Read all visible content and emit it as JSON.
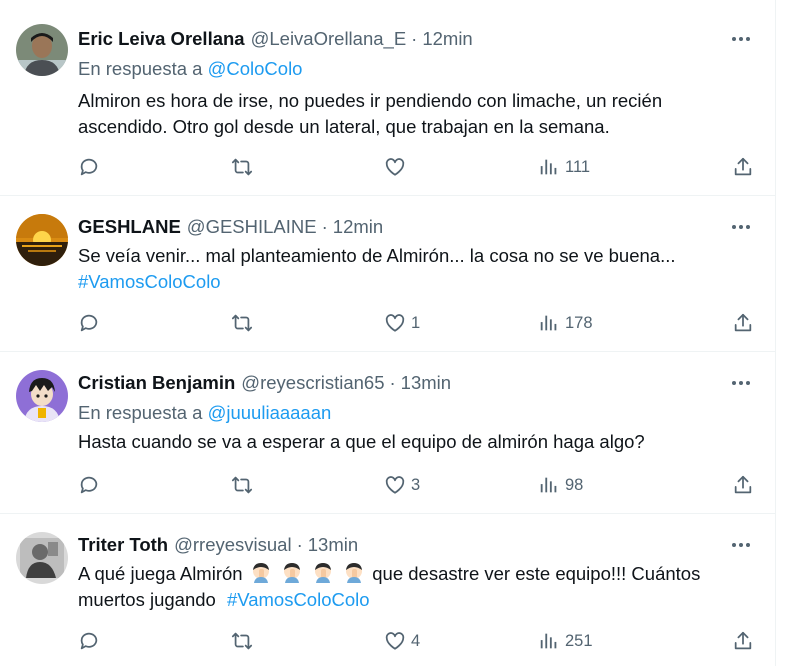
{
  "tweets": [
    {
      "author": "Eric Leiva Orellana",
      "handle": "@LeivaOrellana_E",
      "separator": "·",
      "time": "12min",
      "reply_prefix": "En respuesta a",
      "reply_to": "@ColoColo",
      "text_lines": [
        "Almiron es hora de irse, no puedes ir pendiendo con limache, un recién",
        "ascendido. Otro gol desde un lateral, que trabajan en la semana."
      ],
      "likes": "",
      "views": "111"
    },
    {
      "author": "GESHLANE",
      "handle": "@GESHILAINE",
      "separator": "·",
      "time": "12min",
      "text_lines": [
        "Se veía venir... mal planteamiento de Almirón... la cosa no se ve buena..."
      ],
      "hashtag": "#VamosColoColo",
      "likes": "1",
      "views": "178"
    },
    {
      "author": "Cristian Benjamin",
      "handle": "@reyescristian65",
      "separator": "·",
      "time": "13min",
      "reply_prefix": "En respuesta a",
      "reply_to": "@juuuliaaaaan",
      "text_lines": [
        "Hasta cuando se va a esperar a que el equipo de almirón haga algo?"
      ],
      "likes": "3",
      "views": "98"
    },
    {
      "author": "Triter Toth",
      "handle": "@rreyesvisual",
      "separator": "·",
      "time": "13min",
      "text_before_emoji": "A qué juega Almirón",
      "emoji_count": 4,
      "text_after_emoji": "que desastre ver este equipo!!! Cuántos",
      "text_line2": "muertos jugando",
      "hashtag": "#VamosColoColo",
      "likes": "4",
      "views": "251"
    }
  ],
  "icons": {
    "reply": "reply-icon",
    "retweet": "retweet-icon",
    "like": "heart-icon",
    "views": "views-icon",
    "share": "share-icon",
    "more": "more-icon"
  },
  "colors": {
    "text": "#0f1419",
    "secondary": "#536471",
    "link": "#1d9bf0",
    "divider": "#eff3f4"
  }
}
